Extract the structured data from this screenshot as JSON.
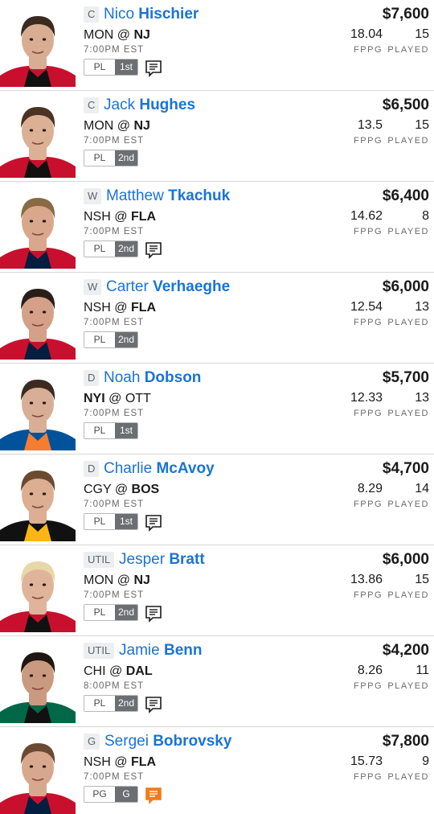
{
  "players": [
    {
      "pos": "C",
      "first": "Nico",
      "last": "Hischier",
      "away": "MON",
      "home": "NJ",
      "bold_team": "home",
      "time": "7:00PM EST",
      "roster_slot": "PL",
      "line": "1st",
      "has_note": true,
      "note_color": "#1a1a1a",
      "salary": "$7,600",
      "fppg": "18.04",
      "played": "15",
      "jersey": "#c8102e",
      "jersey2": "#111111",
      "skin": "#d8ad92",
      "hair": "#3a2a20"
    },
    {
      "pos": "C",
      "first": "Jack",
      "last": "Hughes",
      "away": "MON",
      "home": "NJ",
      "bold_team": "home",
      "time": "7:00PM EST",
      "roster_slot": "PL",
      "line": "2nd",
      "has_note": false,
      "note_color": "#1a1a1a",
      "salary": "$6,500",
      "fppg": "13.5",
      "played": "15",
      "jersey": "#c8102e",
      "jersey2": "#111111",
      "skin": "#dcb095",
      "hair": "#4a3322"
    },
    {
      "pos": "W",
      "first": "Matthew",
      "last": "Tkachuk",
      "away": "NSH",
      "home": "FLA",
      "bold_team": "home",
      "time": "7:00PM EST",
      "roster_slot": "PL",
      "line": "2nd",
      "has_note": true,
      "note_color": "#1a1a1a",
      "salary": "$6,400",
      "fppg": "14.62",
      "played": "8",
      "jersey": "#c8102e",
      "jersey2": "#041e42",
      "skin": "#d9a88c",
      "hair": "#8a6a45"
    },
    {
      "pos": "W",
      "first": "Carter",
      "last": "Verhaeghe",
      "away": "NSH",
      "home": "FLA",
      "bold_team": "home",
      "time": "7:00PM EST",
      "roster_slot": "PL",
      "line": "2nd",
      "has_note": false,
      "note_color": "#1a1a1a",
      "salary": "$6,000",
      "fppg": "12.54",
      "played": "13",
      "jersey": "#c8102e",
      "jersey2": "#041e42",
      "skin": "#d4a087",
      "hair": "#2a1e18"
    },
    {
      "pos": "D",
      "first": "Noah",
      "last": "Dobson",
      "away": "NYI",
      "home": "OTT",
      "bold_team": "away",
      "time": "7:00PM EST",
      "roster_slot": "PL",
      "line": "1st",
      "has_note": false,
      "note_color": "#1a1a1a",
      "salary": "$5,700",
      "fppg": "12.33",
      "played": "13",
      "jersey": "#00539b",
      "jersey2": "#f47d30",
      "skin": "#d8ae96",
      "hair": "#3b2a20"
    },
    {
      "pos": "D",
      "first": "Charlie",
      "last": "McAvoy",
      "away": "CGY",
      "home": "BOS",
      "bold_team": "home",
      "time": "7:00PM EST",
      "roster_slot": "PL",
      "line": "1st",
      "has_note": true,
      "note_color": "#1a1a1a",
      "salary": "$4,700",
      "fppg": "8.29",
      "played": "14",
      "jersey": "#111111",
      "jersey2": "#fcb514",
      "skin": "#dcae92",
      "hair": "#6a4a30"
    },
    {
      "pos": "UTIL",
      "first": "Jesper",
      "last": "Bratt",
      "away": "MON",
      "home": "NJ",
      "bold_team": "home",
      "time": "7:00PM EST",
      "roster_slot": "PL",
      "line": "2nd",
      "has_note": true,
      "note_color": "#1a1a1a",
      "salary": "$6,000",
      "fppg": "13.86",
      "played": "15",
      "jersey": "#c8102e",
      "jersey2": "#111111",
      "skin": "#e0b49a",
      "hair": "#e8d7a8"
    },
    {
      "pos": "UTIL",
      "first": "Jamie",
      "last": "Benn",
      "away": "CHI",
      "home": "DAL",
      "bold_team": "home",
      "time": "8:00PM EST",
      "roster_slot": "PL",
      "line": "2nd",
      "has_note": true,
      "note_color": "#1a1a1a",
      "salary": "$4,200",
      "fppg": "8.26",
      "played": "11",
      "jersey": "#006847",
      "jersey2": "#111111",
      "skin": "#c99a80",
      "hair": "#1e1612"
    },
    {
      "pos": "G",
      "first": "Sergei",
      "last": "Bobrovsky",
      "away": "NSH",
      "home": "FLA",
      "bold_team": "home",
      "time": "7:00PM EST",
      "roster_slot": "PG",
      "line": "G",
      "has_note": true,
      "note_color": "#f07c1c",
      "salary": "$7,800",
      "fppg": "15.73",
      "played": "9",
      "jersey": "#c8102e",
      "jersey2": "#041e42",
      "skin": "#d8a88e",
      "hair": "#6a4a32"
    }
  ],
  "labels": {
    "fppg": "FPPG",
    "played": "PLAYED",
    "at": "@"
  }
}
